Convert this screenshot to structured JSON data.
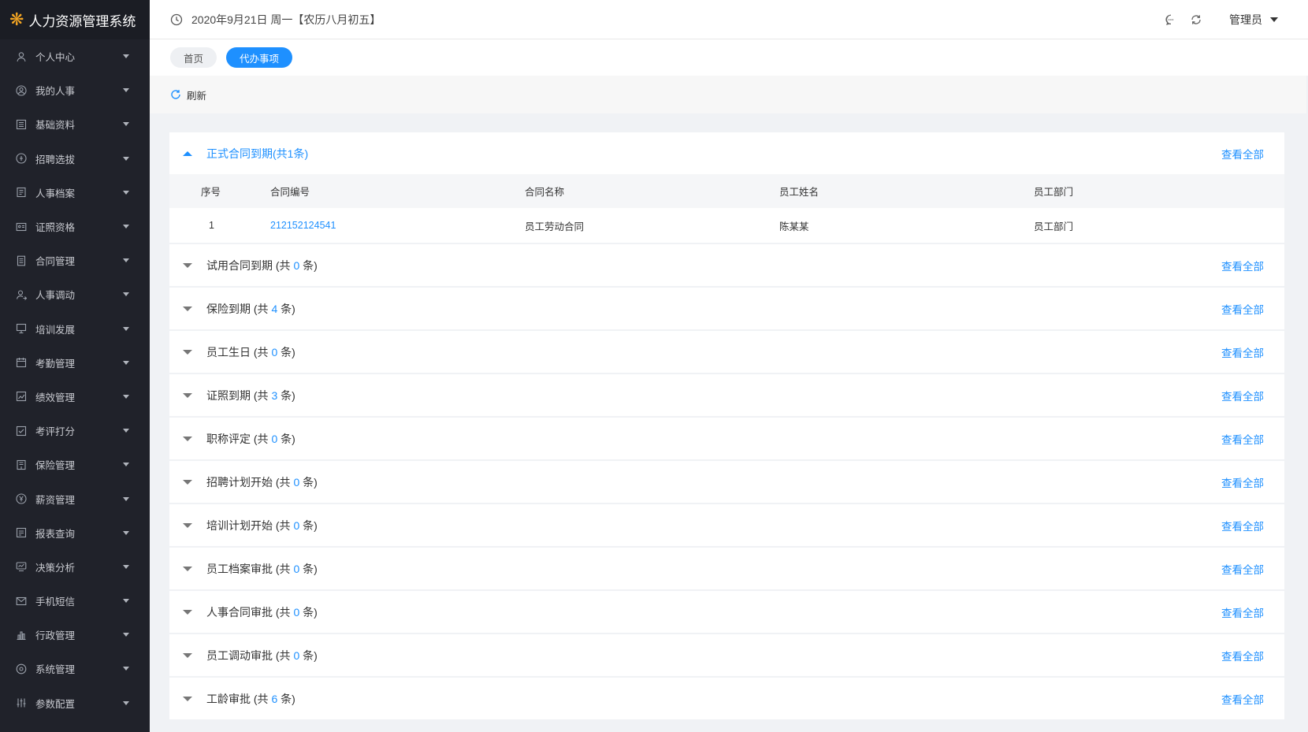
{
  "app": {
    "title": "人力资源管理系统"
  },
  "header": {
    "date": "2020年9月21日 周一【农历八月初五】",
    "user": "管理员"
  },
  "sidebar": {
    "items": [
      {
        "label": "个人中心",
        "icon": "user-icon"
      },
      {
        "label": "我的人事",
        "icon": "user-circle-icon"
      },
      {
        "label": "基础资料",
        "icon": "list-icon"
      },
      {
        "label": "招聘选拔",
        "icon": "badge-icon"
      },
      {
        "label": "人事档案",
        "icon": "archive-icon"
      },
      {
        "label": "证照资格",
        "icon": "id-card-icon"
      },
      {
        "label": "合同管理",
        "icon": "document-icon"
      },
      {
        "label": "人事调动",
        "icon": "transfer-user-icon"
      },
      {
        "label": "培训发展",
        "icon": "presentation-icon"
      },
      {
        "label": "考勤管理",
        "icon": "calendar-icon"
      },
      {
        "label": "绩效管理",
        "icon": "chart-icon"
      },
      {
        "label": "考评打分",
        "icon": "checkbox-icon"
      },
      {
        "label": "保险管理",
        "icon": "shield-doc-icon"
      },
      {
        "label": "薪资管理",
        "icon": "yen-icon"
      },
      {
        "label": "报表查询",
        "icon": "report-icon"
      },
      {
        "label": "决策分析",
        "icon": "monitor-icon"
      },
      {
        "label": "手机短信",
        "icon": "mail-icon"
      },
      {
        "label": "行政管理",
        "icon": "bar-chart-icon"
      },
      {
        "label": "系统管理",
        "icon": "settings-icon"
      },
      {
        "label": "参数配置",
        "icon": "sliders-icon"
      }
    ]
  },
  "tabs": [
    {
      "label": "首页",
      "active": false
    },
    {
      "label": "代办事项",
      "active": true
    }
  ],
  "toolbar": {
    "refresh_label": "刷新"
  },
  "view_all_label": "查看全部",
  "first_panel": {
    "title": "正式合同到期(共1条)",
    "columns": [
      "序号",
      "合同编号",
      "合同名称",
      "员工姓名",
      "员工部门"
    ],
    "rows": [
      {
        "seq": "1",
        "code": "212152124541",
        "name": "员工劳动合同",
        "employee": "陈某某",
        "dept": "员工部门"
      }
    ]
  },
  "panels": [
    {
      "prefix": "试用合同到期 (共 ",
      "count": "0",
      "suffix": " 条)"
    },
    {
      "prefix": "保险到期 (共 ",
      "count": "4",
      "suffix": " 条)"
    },
    {
      "prefix": "员工生日 (共 ",
      "count": "0",
      "suffix": " 条)"
    },
    {
      "prefix": "证照到期 (共 ",
      "count": "3",
      "suffix": " 条)"
    },
    {
      "prefix": "职称评定 (共 ",
      "count": "0",
      "suffix": " 条)"
    },
    {
      "prefix": "招聘计划开始 (共 ",
      "count": "0",
      "suffix": " 条)"
    },
    {
      "prefix": "培训计划开始 (共 ",
      "count": "0",
      "suffix": " 条)"
    },
    {
      "prefix": "员工档案审批 (共 ",
      "count": "0",
      "suffix": " 条)"
    },
    {
      "prefix": "人事合同审批 (共 ",
      "count": "0",
      "suffix": " 条)"
    },
    {
      "prefix": "员工调动审批 (共 ",
      "count": "0",
      "suffix": " 条)"
    },
    {
      "prefix": "工龄审批 (共 ",
      "count": "6",
      "suffix": " 条)"
    }
  ]
}
